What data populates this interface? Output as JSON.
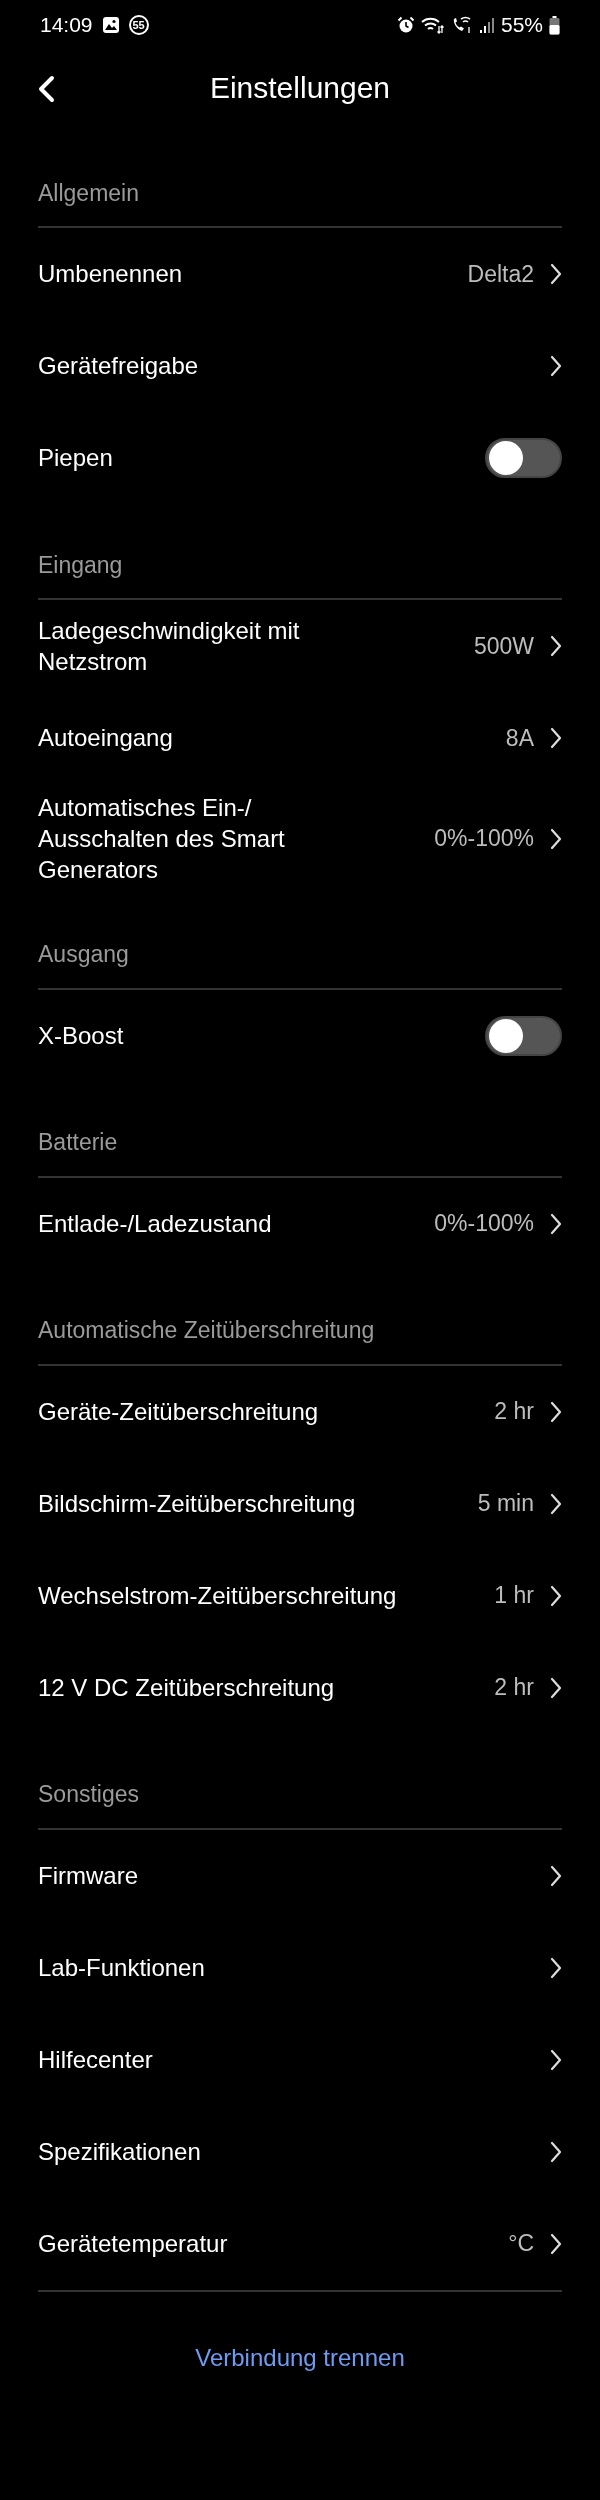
{
  "status_bar": {
    "time": "14:09",
    "notification_count": "55",
    "battery": "55%"
  },
  "header": {
    "title": "Einstellungen"
  },
  "sections": [
    {
      "title": "Allgemein",
      "rows": [
        {
          "kind": "link",
          "label": "Umbenennen",
          "value": "Delta2"
        },
        {
          "kind": "link",
          "label": "Gerätefreigabe"
        },
        {
          "kind": "toggle",
          "label": "Piepen",
          "on": false
        }
      ]
    },
    {
      "title": "Eingang",
      "rows": [
        {
          "kind": "link",
          "label": "Ladegeschwindigkeit mit Netzstrom",
          "value": "500W"
        },
        {
          "kind": "link",
          "label": "Autoeingang",
          "value": "8A"
        },
        {
          "kind": "link",
          "label": "Automatisches Ein-/Ausschalten des Smart Generators",
          "value": "0%-100%"
        }
      ]
    },
    {
      "title": "Ausgang",
      "rows": [
        {
          "kind": "toggle",
          "label": "X-Boost",
          "on": false
        }
      ]
    },
    {
      "title": "Batterie",
      "rows": [
        {
          "kind": "link",
          "label": "Entlade-/Ladezustand",
          "value": "0%-100%"
        }
      ]
    },
    {
      "title": "Automatische Zeitüberschreitung",
      "rows": [
        {
          "kind": "link",
          "label": "Geräte-Zeitüberschreitung",
          "value": "2 hr"
        },
        {
          "kind": "link",
          "label": "Bildschirm-Zeitüberschreitung",
          "value": "5 min"
        },
        {
          "kind": "link",
          "label": "Wechselstrom-Zeitüberschreitung",
          "value": "1 hr"
        },
        {
          "kind": "link",
          "label": "12 V DC Zeitüberschreitung",
          "value": "2 hr"
        }
      ]
    },
    {
      "title": "Sonstiges",
      "rows": [
        {
          "kind": "link",
          "label": "Firmware"
        },
        {
          "kind": "link",
          "label": "Lab-Funktionen"
        },
        {
          "kind": "link",
          "label": "Hilfecenter"
        },
        {
          "kind": "link",
          "label": "Spezifikationen"
        },
        {
          "kind": "link",
          "label": "Gerätetemperatur",
          "value": "°C"
        }
      ]
    }
  ],
  "footer": {
    "disconnect": "Verbindung trennen"
  }
}
